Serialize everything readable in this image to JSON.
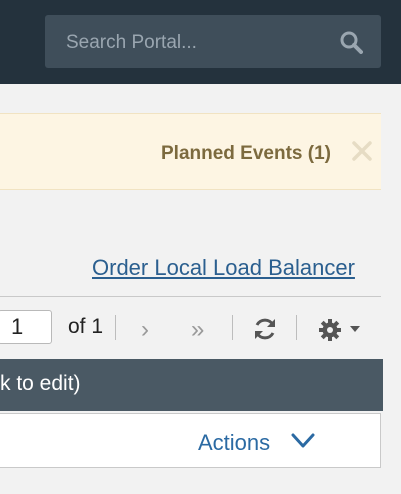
{
  "search": {
    "placeholder": "Search Portal..."
  },
  "alert": {
    "text": "Planned Events (1)"
  },
  "order_link": "Order Local Load Balancer",
  "pagination": {
    "current_page": "1",
    "of_text": "of 1",
    "next": "›",
    "last": "»"
  },
  "table": {
    "header_text": "k to edit)",
    "actions_label": "Actions"
  },
  "colors": {
    "topbar": "#24323d",
    "alert_bg": "#fdf5e3",
    "alert_text": "#7c6a3e",
    "link": "#2b5f8f",
    "header": "#4a5964",
    "actions": "#2b6aa3"
  },
  "icons": [
    "search-icon",
    "close-icon",
    "refresh-icon",
    "gear-icon",
    "caret-down-icon",
    "chevron-down-icon"
  ]
}
